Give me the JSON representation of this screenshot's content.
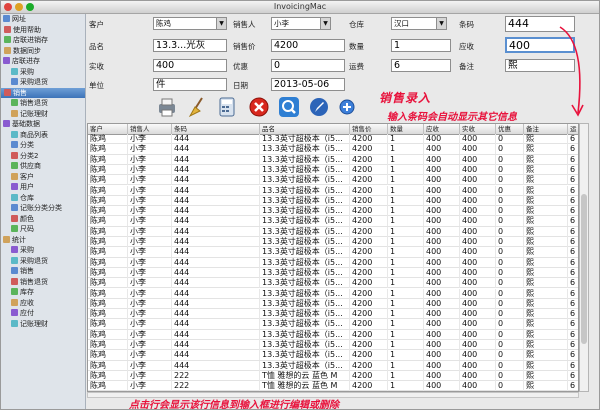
{
  "window": {
    "title": "InvoicingMac"
  },
  "colors": {
    "annotation": "#e8123c",
    "selection": "#3d73b8"
  },
  "sidebar": {
    "items": [
      {
        "label": "网址",
        "icon": "folder-icon",
        "level": 0
      },
      {
        "label": "使用帮助",
        "icon": "help-icon",
        "level": 1
      },
      {
        "label": "店联进销存",
        "icon": "store-icon",
        "level": 1
      },
      {
        "label": "数据同步",
        "icon": "sync-icon",
        "level": 1
      },
      {
        "label": "店联进存",
        "icon": "store-icon",
        "level": 0
      },
      {
        "label": "采购",
        "icon": "cart-icon",
        "level": 2
      },
      {
        "label": "采购退货",
        "icon": "return-icon",
        "level": 2
      },
      {
        "label": "销售",
        "icon": "sales-icon",
        "level": 1,
        "selected": true
      },
      {
        "label": "销售退货",
        "icon": "return-icon",
        "level": 2
      },
      {
        "label": "记账理财",
        "icon": "ledger-icon",
        "level": 2
      },
      {
        "label": "基础数据",
        "icon": "data-icon",
        "level": 0
      },
      {
        "label": "商品列表",
        "icon": "list-icon",
        "level": 2
      },
      {
        "label": "分类",
        "icon": "tag-icon",
        "level": 2
      },
      {
        "label": "分类2",
        "icon": "tag-icon",
        "level": 2
      },
      {
        "label": "供应商",
        "icon": "supplier-icon",
        "level": 2
      },
      {
        "label": "客户",
        "icon": "customer-icon",
        "level": 2
      },
      {
        "label": "用户",
        "icon": "user-icon",
        "level": 2
      },
      {
        "label": "仓库",
        "icon": "warehouse-icon",
        "level": 2
      },
      {
        "label": "记账分类分类",
        "icon": "ledger-icon",
        "level": 2
      },
      {
        "label": "颜色",
        "icon": "color-icon",
        "level": 2
      },
      {
        "label": "尺码",
        "icon": "size-icon",
        "level": 2
      },
      {
        "label": "统计",
        "icon": "stats-icon",
        "level": 0
      },
      {
        "label": "采购",
        "icon": "cart-icon",
        "level": 2
      },
      {
        "label": "采购退货",
        "icon": "return-icon",
        "level": 2
      },
      {
        "label": "销售",
        "icon": "sales-icon",
        "level": 2
      },
      {
        "label": "销售退货",
        "icon": "return-icon",
        "level": 2
      },
      {
        "label": "库存",
        "icon": "stock-icon",
        "level": 2
      },
      {
        "label": "应收",
        "icon": "receivable-icon",
        "level": 2
      },
      {
        "label": "应付",
        "icon": "payable-icon",
        "level": 2
      },
      {
        "label": "记账理财",
        "icon": "ledger-icon",
        "level": 2
      }
    ]
  },
  "form": {
    "customer": {
      "label": "客户",
      "value": "陈鸡"
    },
    "salesperson": {
      "label": "销售人",
      "value": "小李"
    },
    "warehouse": {
      "label": "仓库",
      "value": "汉口"
    },
    "barcode": {
      "label": "条码",
      "value": "444"
    },
    "product_name": {
      "label": "品名",
      "value": "13.3...光灰"
    },
    "sale_price": {
      "label": "销售价",
      "value": "4200"
    },
    "quantity": {
      "label": "数量",
      "value": "1"
    },
    "receivable": {
      "label": "应收",
      "value": "400"
    },
    "received": {
      "label": "实收",
      "value": "400"
    },
    "discount": {
      "label": "优惠",
      "value": "0"
    },
    "shipping": {
      "label": "运费",
      "value": "6"
    },
    "remark": {
      "label": "备注",
      "value": "熙"
    },
    "unit": {
      "label": "单位",
      "value": "件"
    },
    "date": {
      "label": "日期",
      "value": "2013-05-06"
    }
  },
  "toolbar": {
    "buttons": [
      {
        "name": "print-button",
        "icon": "printer-icon"
      },
      {
        "name": "clear-button",
        "icon": "broom-icon"
      },
      {
        "name": "calculator-button",
        "icon": "calculator-icon"
      },
      {
        "name": "delete-button",
        "icon": "delete-icon"
      },
      {
        "name": "search-button",
        "icon": "search-icon"
      },
      {
        "name": "edit-button",
        "icon": "pen-icon"
      },
      {
        "name": "add-button",
        "icon": "plus-icon"
      }
    ]
  },
  "annotations": {
    "sales_entry": "销售录入",
    "barcode_hint": "输入条码会自动显示其它信息",
    "row_hint": "点击行会显示该行信息到输入框进行编辑或删除"
  },
  "table": {
    "columns": [
      "客户",
      "销售人",
      "条码",
      "品名",
      "销售价",
      "数量",
      "应收",
      "实收",
      "优惠",
      "备注",
      "运"
    ],
    "rows": [
      [
        "陈鸡",
        "小李",
        "444",
        "13.3英寸超极本（i5...",
        "4200",
        "1",
        "400",
        "400",
        "0",
        "熙",
        "6"
      ],
      [
        "陈鸡",
        "小李",
        "444",
        "13.3英寸超极本（i5...",
        "4200",
        "1",
        "400",
        "400",
        "0",
        "熙",
        "6"
      ],
      [
        "陈鸡",
        "小李",
        "444",
        "13.3英寸超极本（i5...",
        "4200",
        "1",
        "400",
        "400",
        "0",
        "熙",
        "6"
      ],
      [
        "陈鸡",
        "小李",
        "444",
        "13.3英寸超极本（i5...",
        "4200",
        "1",
        "400",
        "400",
        "0",
        "熙",
        "6"
      ],
      [
        "陈鸡",
        "小李",
        "444",
        "13.3英寸超极本（i5...",
        "4200",
        "1",
        "400",
        "400",
        "0",
        "熙",
        "6"
      ],
      [
        "陈鸡",
        "小李",
        "444",
        "13.3英寸超极本（i5...",
        "4200",
        "1",
        "400",
        "400",
        "0",
        "熙",
        "6"
      ],
      [
        "陈鸡",
        "小李",
        "444",
        "13.3英寸超极本（i5...",
        "4200",
        "1",
        "400",
        "400",
        "0",
        "熙",
        "6"
      ],
      [
        "陈鸡",
        "小李",
        "444",
        "13.3英寸超极本（i5...",
        "4200",
        "1",
        "400",
        "400",
        "0",
        "熙",
        "6"
      ],
      [
        "陈鸡",
        "小李",
        "444",
        "13.3英寸超极本（i5...",
        "4200",
        "1",
        "400",
        "400",
        "0",
        "熙",
        "6"
      ],
      [
        "陈鸡",
        "小李",
        "444",
        "13.3英寸超极本（i5...",
        "4200",
        "1",
        "400",
        "400",
        "0",
        "熙",
        "6"
      ],
      [
        "陈鸡",
        "小李",
        "444",
        "13.3英寸超极本（i5...",
        "4200",
        "1",
        "400",
        "400",
        "0",
        "熙",
        "6"
      ],
      [
        "陈鸡",
        "小李",
        "444",
        "13.3英寸超极本（i5...",
        "4200",
        "1",
        "400",
        "400",
        "0",
        "熙",
        "6"
      ],
      [
        "陈鸡",
        "小李",
        "444",
        "13.3英寸超极本（i5...",
        "4200",
        "1",
        "400",
        "400",
        "0",
        "熙",
        "6"
      ],
      [
        "陈鸡",
        "小李",
        "444",
        "13.3英寸超极本（i5...",
        "4200",
        "1",
        "400",
        "400",
        "0",
        "熙",
        "6"
      ],
      [
        "陈鸡",
        "小李",
        "444",
        "13.3英寸超极本（i5...",
        "4200",
        "1",
        "400",
        "400",
        "0",
        "熙",
        "6"
      ],
      [
        "陈鸡",
        "小李",
        "444",
        "13.3英寸超极本（i5...",
        "4200",
        "1",
        "400",
        "400",
        "0",
        "熙",
        "6"
      ],
      [
        "陈鸡",
        "小李",
        "444",
        "13.3英寸超极本（i5...",
        "4200",
        "1",
        "400",
        "400",
        "0",
        "熙",
        "6"
      ],
      [
        "陈鸡",
        "小李",
        "444",
        "13.3英寸超极本（i5...",
        "4200",
        "1",
        "400",
        "400",
        "0",
        "熙",
        "6"
      ],
      [
        "陈鸡",
        "小李",
        "444",
        "13.3英寸超极本（i5...",
        "4200",
        "1",
        "400",
        "400",
        "0",
        "熙",
        "6"
      ],
      [
        "陈鸡",
        "小李",
        "444",
        "13.3英寸超极本（i5...",
        "4200",
        "1",
        "400",
        "400",
        "0",
        "熙",
        "6"
      ],
      [
        "陈鸡",
        "小李",
        "444",
        "13.3英寸超极本（i5...",
        "4200",
        "1",
        "400",
        "400",
        "0",
        "熙",
        "6"
      ],
      [
        "陈鸡",
        "小李",
        "444",
        "13.3英寸超极本（i5...",
        "4200",
        "1",
        "400",
        "400",
        "0",
        "熙",
        "6"
      ],
      [
        "陈鸡",
        "小李",
        "444",
        "13.3英寸超极本（i5...",
        "4200",
        "1",
        "400",
        "400",
        "0",
        "熙",
        "6"
      ],
      [
        "陈鸡",
        "小李",
        "222",
        "T恤 雅想的云 蓝色 M",
        "4200",
        "1",
        "400",
        "400",
        "0",
        "熙",
        "6"
      ],
      [
        "陈鸡",
        "小李",
        "222",
        "T恤 雅想的云 蓝色 M",
        "4200",
        "1",
        "400",
        "400",
        "0",
        "熙",
        "6"
      ]
    ]
  }
}
